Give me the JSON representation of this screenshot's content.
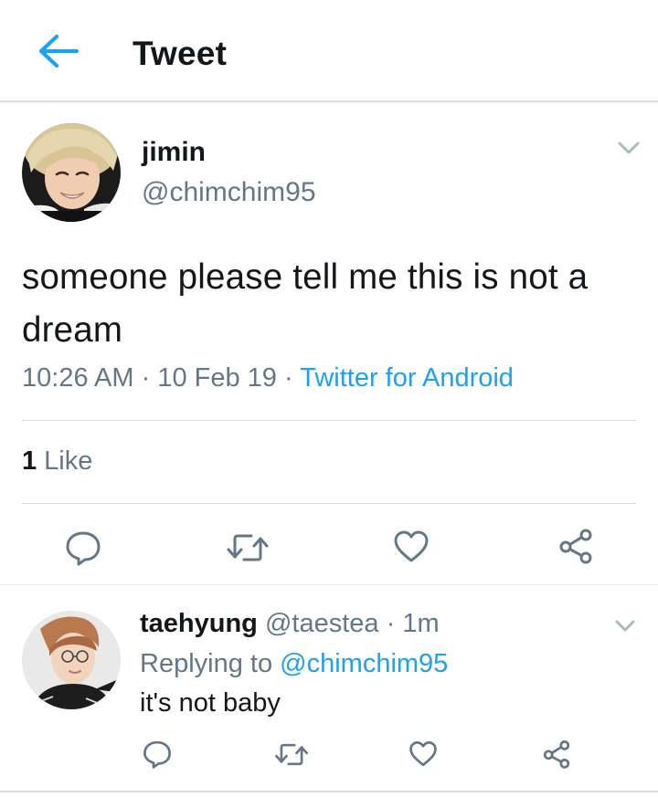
{
  "header": {
    "title": "Tweet",
    "back_icon": "arrow-left-icon",
    "accent": "#1da1f2"
  },
  "tweet": {
    "author_name": "jimin",
    "author_handle": "@chimchim95",
    "text": "someone please tell me this is not a dream",
    "time": "10:26 AM",
    "date": "10 Feb 19",
    "separator": "·",
    "source": "Twitter for Android",
    "like_count": "1",
    "like_label": "Like",
    "menu_icon": "chevron-down-icon",
    "actions": [
      "reply-icon",
      "retweet-icon",
      "like-icon",
      "share-icon"
    ]
  },
  "reply": {
    "author_name": "taehyung",
    "author_handle": "@taestea",
    "separator": "·",
    "time": "1m",
    "replying_prefix": "Replying to",
    "replying_mention": "@chimchim95",
    "text": "it's not baby",
    "menu_icon": "chevron-down-icon",
    "actions": [
      "reply-icon",
      "retweet-icon",
      "like-icon",
      "share-icon"
    ]
  },
  "colors": {
    "text": "#14171a",
    "secondary": "#657786",
    "link": "#1da1f2",
    "divider": "#d8dde1"
  }
}
